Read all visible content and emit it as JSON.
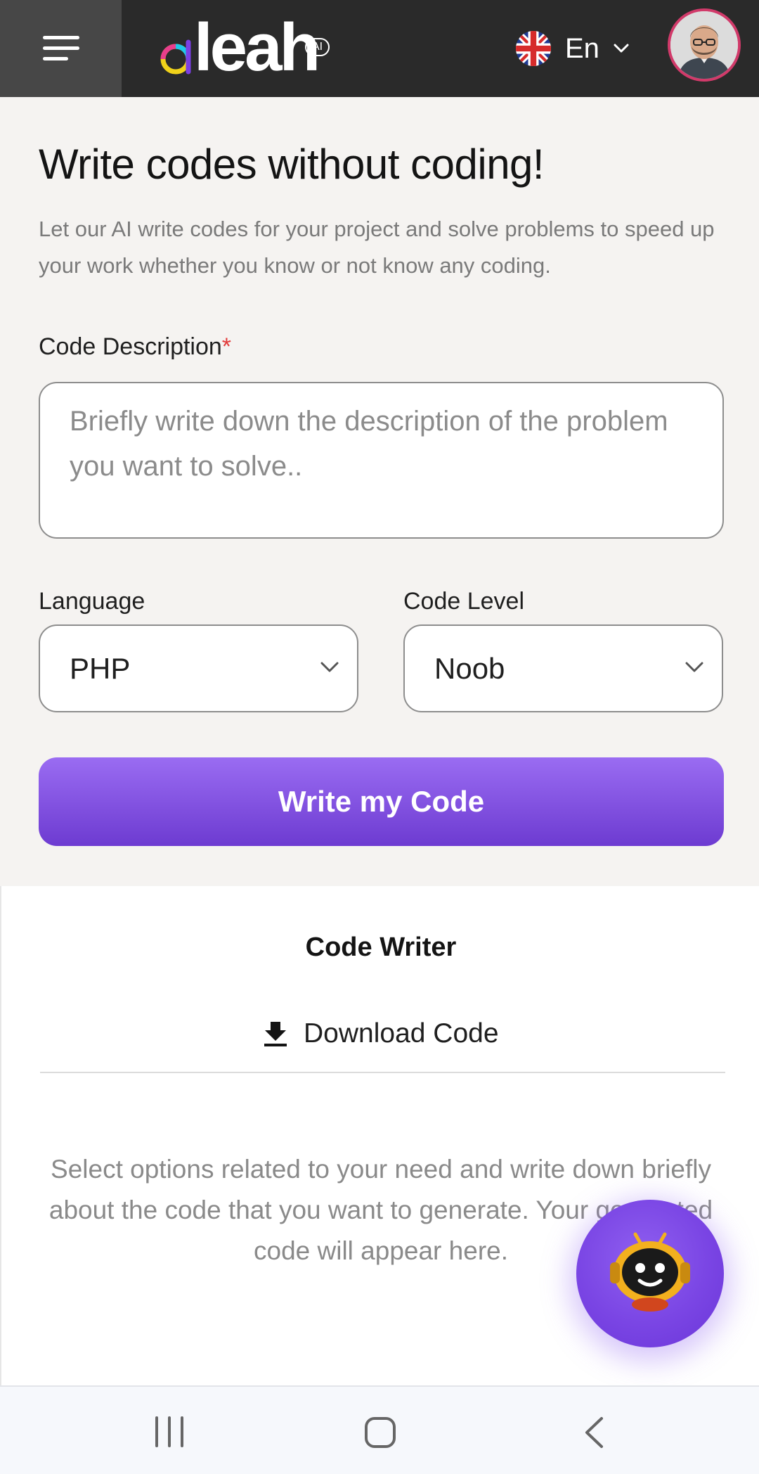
{
  "header": {
    "menu_icon": "hamburger-menu-icon",
    "logo_text": "leah",
    "logo_badge": "AI",
    "language": {
      "flag_icon": "uk-flag-icon",
      "label": "En"
    },
    "avatar_icon": "user-avatar"
  },
  "form": {
    "title": "Write codes without coding!",
    "subtitle": "Let our AI write codes for your project and solve problems to speed up your work whether you know or not know any coding.",
    "description_label": "Code Description",
    "required_mark": "*",
    "description_placeholder": "Briefly write down the description of the problem you want to solve..",
    "description_value": "",
    "language_label": "Language",
    "language_value": "PHP",
    "level_label": "Code Level",
    "level_value": "Noob",
    "submit_label": "Write my Code"
  },
  "output": {
    "title": "Code Writer",
    "download_label": "Download Code",
    "empty_message": "Select options related to your need and write down briefly about the code that you want to generate. Your generated code will appear here."
  },
  "assistant_fab": {
    "icon": "robot-assistant-icon"
  },
  "system_nav": {
    "recents_icon": "recent-apps-icon",
    "home_icon": "home-icon",
    "back_icon": "back-icon"
  },
  "colors": {
    "header_bg": "#2a2a2a",
    "accent": "#7c4ddd",
    "required": "#e23b3b",
    "page_bg": "#f5f3f1"
  }
}
